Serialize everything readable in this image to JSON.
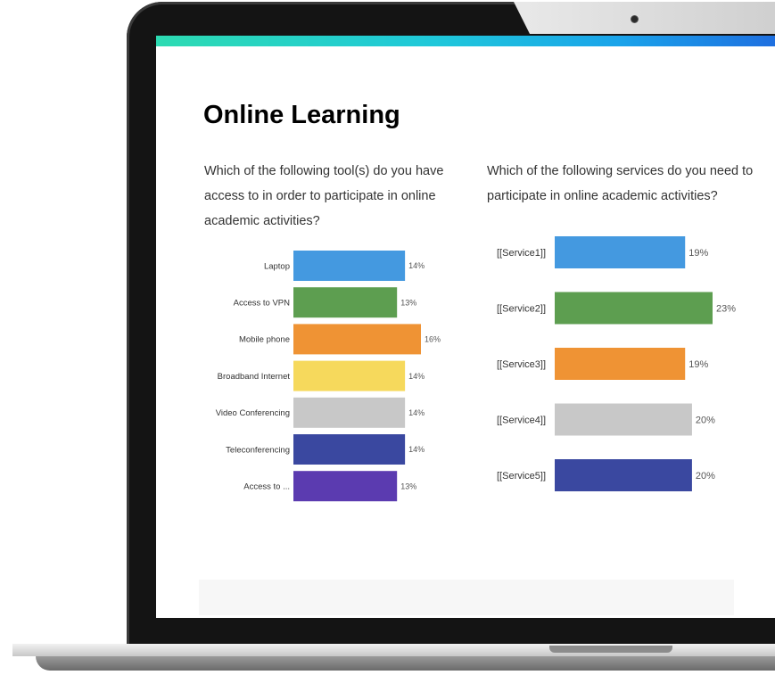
{
  "page": {
    "title": "Online Learning"
  },
  "colors": {
    "accent_gradient": [
      "#2ddbb2",
      "#1fc8da",
      "#1aa3ea",
      "#1e6fe0"
    ]
  },
  "questions": {
    "tools": "Which of the following tool(s) do you have access to in order to participate in online academic activities?",
    "services": "Which of the following services do you need to participate in online academic activities?"
  },
  "chart_data": [
    {
      "type": "bar",
      "orientation": "horizontal",
      "categories": [
        "Laptop",
        "Access to VPN",
        "Mobile phone",
        "Broadband Internet",
        "Video Conferencing",
        "Teleconferencing",
        "Access to ..."
      ],
      "values": [
        14,
        13,
        16,
        14,
        14,
        14,
        13
      ],
      "value_labels": [
        "14%",
        "13%",
        "16%",
        "14%",
        "14%",
        "14%",
        "13%"
      ],
      "colors": [
        "#4499e0",
        "#5d9e50",
        "#ef9334",
        "#f6d95c",
        "#c8c8c8",
        "#3a48a0",
        "#5b3bb0"
      ],
      "xlim": [
        0,
        16
      ]
    },
    {
      "type": "bar",
      "orientation": "horizontal",
      "categories": [
        "[[Service1]]",
        "[[Service2]]",
        "[[Service3]]",
        "[[Service4]]",
        "[[Service5]]"
      ],
      "values": [
        19,
        23,
        19,
        20,
        20
      ],
      "value_labels": [
        "19%",
        "23%",
        "19%",
        "20%",
        "20%"
      ],
      "colors": [
        "#4499e0",
        "#5d9e50",
        "#ef9334",
        "#c8c8c8",
        "#3a48a0"
      ],
      "xlim": [
        0,
        23
      ]
    }
  ]
}
